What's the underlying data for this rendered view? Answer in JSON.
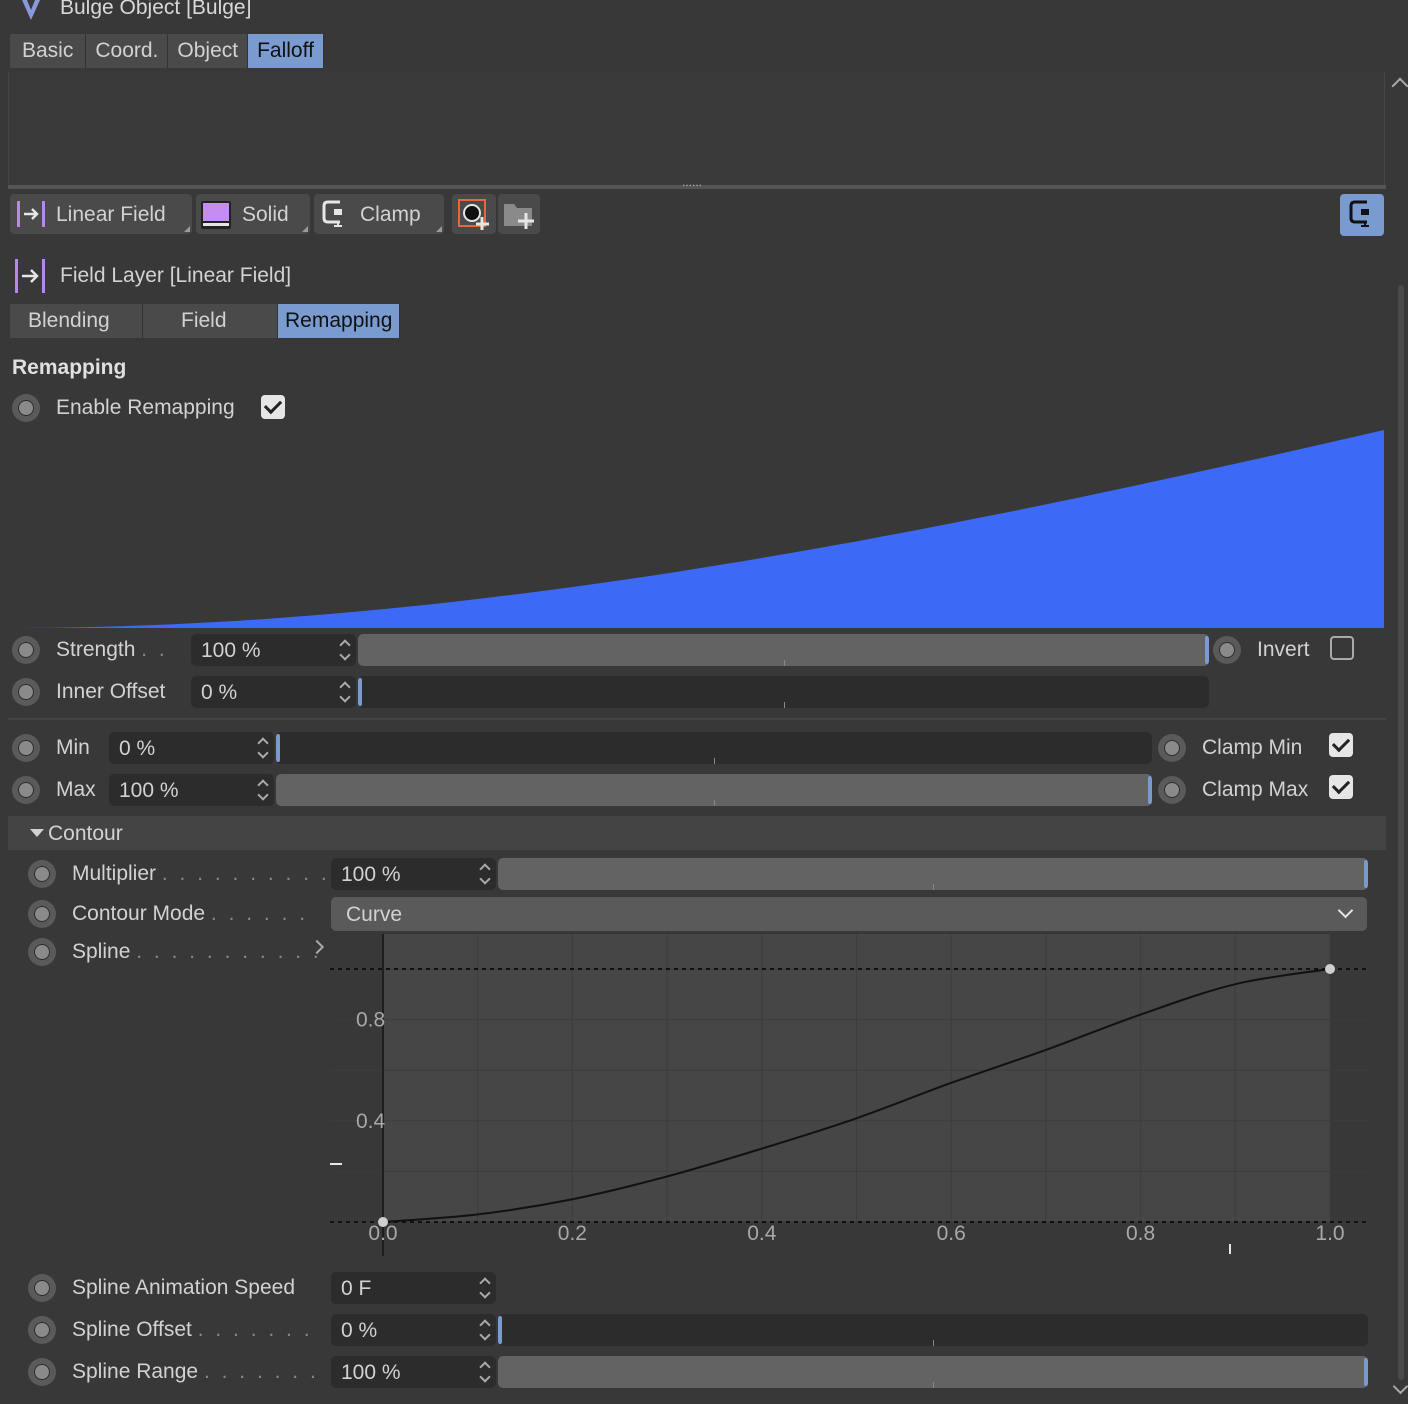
{
  "header": {
    "title": "Bulge Object [Bulge]"
  },
  "object_tabs": [
    {
      "label": "Basic",
      "active": false
    },
    {
      "label": "Coord.",
      "active": false
    },
    {
      "label": "Object",
      "active": false
    },
    {
      "label": "Falloff",
      "active": true
    }
  ],
  "field_list": {
    "resize_handle": "......",
    "layers": [
      {
        "label": "Linear Field",
        "icon": "linear-field-icon"
      },
      {
        "label": "Solid",
        "icon": "solid-field-icon"
      },
      {
        "label": "Clamp",
        "icon": "clamp-icon"
      }
    ],
    "add_buttons": [
      "add-field-icon",
      "add-folder-icon"
    ],
    "right_button_icon": "clamp-icon"
  },
  "field_layer": {
    "title": "Field Layer [Linear Field]",
    "tabs": [
      {
        "label": "Blending",
        "active": false
      },
      {
        "label": "Field",
        "active": false
      },
      {
        "label": "Remapping",
        "active": true
      }
    ]
  },
  "remapping": {
    "section_title": "Remapping",
    "enable_label": "Enable Remapping",
    "enable_checked": true,
    "preview_color": "#3c69f5",
    "strength": {
      "label": "Strength",
      "value": "100 %",
      "fraction": 1.0
    },
    "invert": {
      "label": "Invert",
      "checked": false
    },
    "inner_offset": {
      "label": "Inner Offset",
      "value": "0 %",
      "fraction": 0.0
    },
    "min": {
      "label": "Min",
      "value": "0 %",
      "fraction": 0.0
    },
    "max": {
      "label": "Max",
      "value": "100 %",
      "fraction": 1.0
    },
    "clamp_min": {
      "label": "Clamp Min",
      "checked": true
    },
    "clamp_max": {
      "label": "Clamp Max",
      "checked": true
    }
  },
  "contour": {
    "title": "Contour",
    "multiplier": {
      "label": "Multiplier",
      "value": "100 %",
      "fraction": 1.0
    },
    "mode": {
      "label": "Contour Mode",
      "value": "Curve"
    },
    "spline_label": "Spline",
    "spline_anim_speed": {
      "label": "Spline Animation Speed",
      "value": "0 F"
    },
    "spline_offset": {
      "label": "Spline Offset",
      "value": "0 %",
      "fraction": 0.0
    },
    "spline_range": {
      "label": "Spline Range",
      "value": "100 %",
      "fraction": 1.0
    }
  },
  "chart_data": {
    "type": "line",
    "x_ticks": [
      "0.0",
      "0.2",
      "0.4",
      "0.6",
      "0.8",
      "1.0"
    ],
    "y_ticks": [
      "0.8",
      "0.4"
    ],
    "xlim": [
      0,
      1
    ],
    "ylim": [
      0,
      1
    ],
    "grid": true,
    "series": [
      {
        "x": [
          0.0,
          0.1,
          0.2,
          0.3,
          0.4,
          0.5,
          0.6,
          0.7,
          0.8,
          0.9,
          1.0
        ],
        "y": [
          0.0,
          0.03,
          0.09,
          0.18,
          0.29,
          0.41,
          0.55,
          0.68,
          0.82,
          0.94,
          1.0
        ]
      }
    ],
    "points": [
      {
        "x": 0.0,
        "y": 0.0
      },
      {
        "x": 1.0,
        "y": 1.0
      }
    ],
    "line_color": "#111111"
  }
}
